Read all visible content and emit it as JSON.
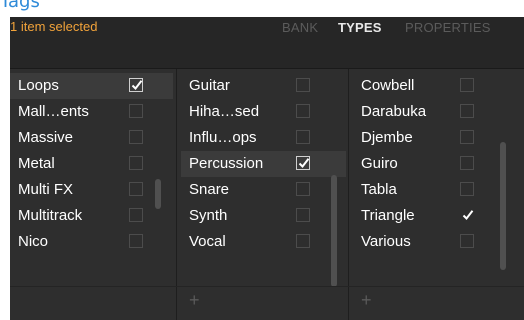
{
  "page_title_partial": "Tags",
  "selection_status": "1 item selected",
  "tabs": {
    "bank": "BANK",
    "types": "TYPES",
    "properties": "PROPERTIES"
  },
  "columns": [
    {
      "items": [
        {
          "label": "Loops",
          "checked": true
        },
        {
          "label": "Mall…ents",
          "checked": false
        },
        {
          "label": "Massive",
          "checked": false
        },
        {
          "label": "Metal",
          "checked": false
        },
        {
          "label": "Multi FX",
          "checked": false
        },
        {
          "label": "Multitrack",
          "checked": false
        },
        {
          "label": "Nico",
          "checked": false
        }
      ]
    },
    {
      "items": [
        {
          "label": "Guitar",
          "checked": false
        },
        {
          "label": "Hiha…sed",
          "checked": false
        },
        {
          "label": "Influ…ops",
          "checked": false
        },
        {
          "label": "Percussion",
          "checked": true
        },
        {
          "label": "Snare",
          "checked": false
        },
        {
          "label": "Synth",
          "checked": false
        },
        {
          "label": "Vocal",
          "checked": false
        }
      ],
      "add_label": "+"
    },
    {
      "items": [
        {
          "label": "Cowbell",
          "checked": false
        },
        {
          "label": "Darabuka",
          "checked": false
        },
        {
          "label": "Djembe",
          "checked": false
        },
        {
          "label": "Guiro",
          "checked": false
        },
        {
          "label": "Tabla",
          "checked": false
        },
        {
          "label": "Triangle",
          "checked": true
        },
        {
          "label": "Various",
          "checked": false
        }
      ],
      "add_label": "+"
    }
  ],
  "colors": {
    "accent_orange": "#f2a33a",
    "panel_bg": "#2e2e2e",
    "header_bg": "#262626",
    "highlight_bg": "#3b3b3b",
    "link_blue": "#2e8ad8"
  }
}
